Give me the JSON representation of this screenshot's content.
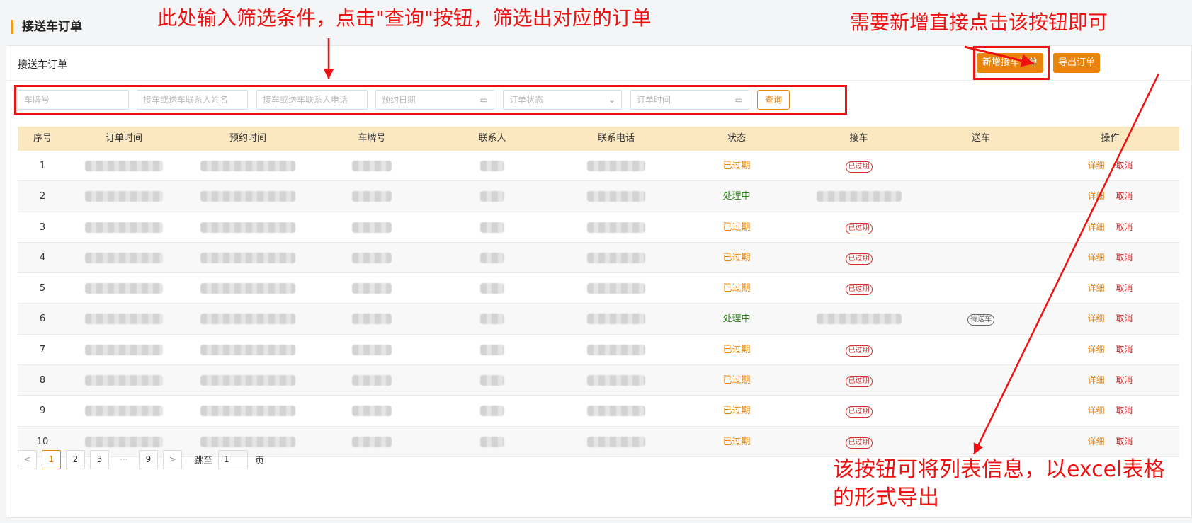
{
  "page_title": "接送车订单",
  "card_title": "接送车订单",
  "buttons": {
    "add_order": "新增接车订单",
    "export_order": "导出订单",
    "query": "查询"
  },
  "filters": {
    "plate": "车牌号",
    "contact_name": "接车或送车联系人姓名",
    "contact_phone": "接车或送车联系人电话",
    "booking_date": "预约日期",
    "order_status": "订单状态",
    "order_time": "订单时间"
  },
  "table": {
    "headers": [
      "序号",
      "订单时间",
      "预约时间",
      "车牌号",
      "联系人",
      "联系电话",
      "状态",
      "接车",
      "送车",
      "操作"
    ],
    "rows": [
      {
        "no": "1",
        "status": "已过期",
        "pickup": "已过期",
        "dropoff": "",
        "detail": "详细",
        "cancel": "取消"
      },
      {
        "no": "2",
        "status": "处理中",
        "pickup": "",
        "dropoff": "",
        "detail": "详细",
        "cancel": "取消"
      },
      {
        "no": "3",
        "status": "已过期",
        "pickup": "已过期",
        "dropoff": "",
        "detail": "详细",
        "cancel": "取消"
      },
      {
        "no": "4",
        "status": "已过期",
        "pickup": "已过期",
        "dropoff": "",
        "detail": "详细",
        "cancel": "取消"
      },
      {
        "no": "5",
        "status": "已过期",
        "pickup": "已过期",
        "dropoff": "",
        "detail": "详细",
        "cancel": "取消"
      },
      {
        "no": "6",
        "status": "处理中",
        "pickup": "",
        "dropoff": "待送车",
        "detail": "详细",
        "cancel": "取消"
      },
      {
        "no": "7",
        "status": "已过期",
        "pickup": "已过期",
        "dropoff": "",
        "detail": "详细",
        "cancel": "取消"
      },
      {
        "no": "8",
        "status": "已过期",
        "pickup": "已过期",
        "dropoff": "",
        "detail": "详细",
        "cancel": "取消"
      },
      {
        "no": "9",
        "status": "已过期",
        "pickup": "已过期",
        "dropoff": "",
        "detail": "详细",
        "cancel": "取消"
      },
      {
        "no": "10",
        "status": "已过期",
        "pickup": "已过期",
        "dropoff": "",
        "detail": "详细",
        "cancel": "取消"
      }
    ]
  },
  "pagination": {
    "prev": "<",
    "pages": [
      "1",
      "2",
      "3"
    ],
    "dots": "···",
    "last": "9",
    "next": ">",
    "jump_label": "跳至",
    "jump_value": "1",
    "page_unit": "页"
  },
  "annotations": {
    "filter_note": "此处输入筛选条件，点击\"查询\"按钮，筛选出对应的订单",
    "add_note": "需要新增直接点击该按钮即可",
    "export_note_line1": "该按钮可将列表信息，以excel表格",
    "export_note_line2": "的形式导出"
  },
  "colors": {
    "accent": "#e8840c",
    "header_bg": "#fbe7c0",
    "annotation": "#ee1111",
    "processing": "#2e7d1a"
  }
}
